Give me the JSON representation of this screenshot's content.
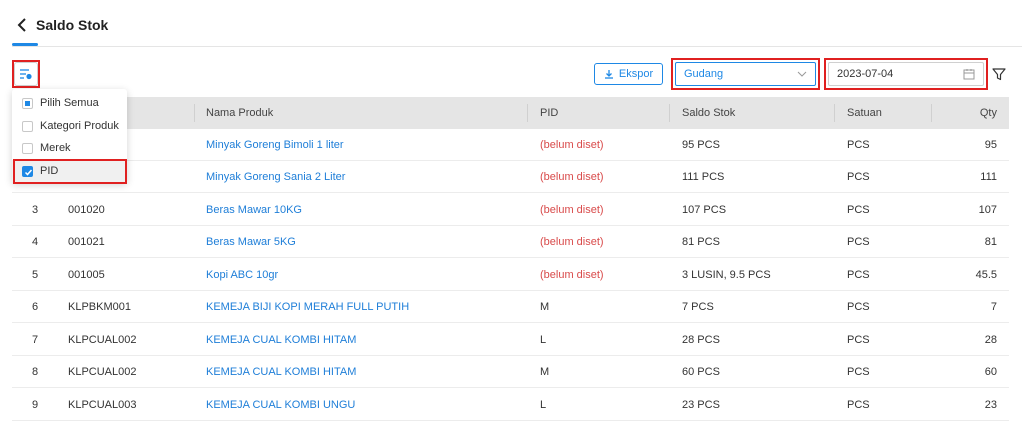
{
  "page": {
    "title": "Saldo Stok"
  },
  "toolbar": {
    "export_label": "Ekspor",
    "warehouse_value": "Gudang",
    "date_value": "2023-07-04"
  },
  "column_menu": {
    "items": [
      {
        "label": "Pilih Semua",
        "state": "indeterminate"
      },
      {
        "label": "Kategori Produk",
        "state": "unchecked"
      },
      {
        "label": "Merek",
        "state": "unchecked"
      },
      {
        "label": "PID",
        "state": "checked"
      }
    ]
  },
  "table": {
    "headers": {
      "name": "Nama Produk",
      "pid": "PID",
      "stock": "Saldo Stok",
      "unit": "Satuan",
      "qty": "Qty"
    },
    "rows": [
      {
        "no": "",
        "code": "",
        "name": "Minyak Goreng Bimoli 1 liter",
        "pid": "(belum diset)",
        "stock": "95 PCS",
        "unit": "PCS",
        "qty": "95"
      },
      {
        "no": "",
        "code": "",
        "name": "Minyak Goreng Sania 2 Liter",
        "pid": "(belum diset)",
        "stock": "111 PCS",
        "unit": "PCS",
        "qty": "111"
      },
      {
        "no": "3",
        "code": "001020",
        "name": "Beras Mawar 10KG",
        "pid": "(belum diset)",
        "stock": "107 PCS",
        "unit": "PCS",
        "qty": "107"
      },
      {
        "no": "4",
        "code": "001021",
        "name": "Beras Mawar 5KG",
        "pid": "(belum diset)",
        "stock": "81 PCS",
        "unit": "PCS",
        "qty": "81"
      },
      {
        "no": "5",
        "code": "001005",
        "name": "Kopi ABC 10gr",
        "pid": "(belum diset)",
        "stock": "3 LUSIN, 9.5 PCS",
        "unit": "PCS",
        "qty": "45.5"
      },
      {
        "no": "6",
        "code": "KLPBKM001",
        "name": "KEMEJA BIJI KOPI MERAH FULL PUTIH",
        "pid": "M",
        "stock": "7 PCS",
        "unit": "PCS",
        "qty": "7"
      },
      {
        "no": "7",
        "code": "KLPCUAL002",
        "name": "KEMEJA CUAL KOMBI HITAM",
        "pid": "L",
        "stock": "28 PCS",
        "unit": "PCS",
        "qty": "28"
      },
      {
        "no": "8",
        "code": "KLPCUAL002",
        "name": "KEMEJA CUAL KOMBI HITAM",
        "pid": "M",
        "stock": "60 PCS",
        "unit": "PCS",
        "qty": "60"
      },
      {
        "no": "9",
        "code": "KLPCUAL003",
        "name": "KEMEJA CUAL KOMBI UNGU",
        "pid": "L",
        "stock": "23 PCS",
        "unit": "PCS",
        "qty": "23"
      }
    ]
  }
}
